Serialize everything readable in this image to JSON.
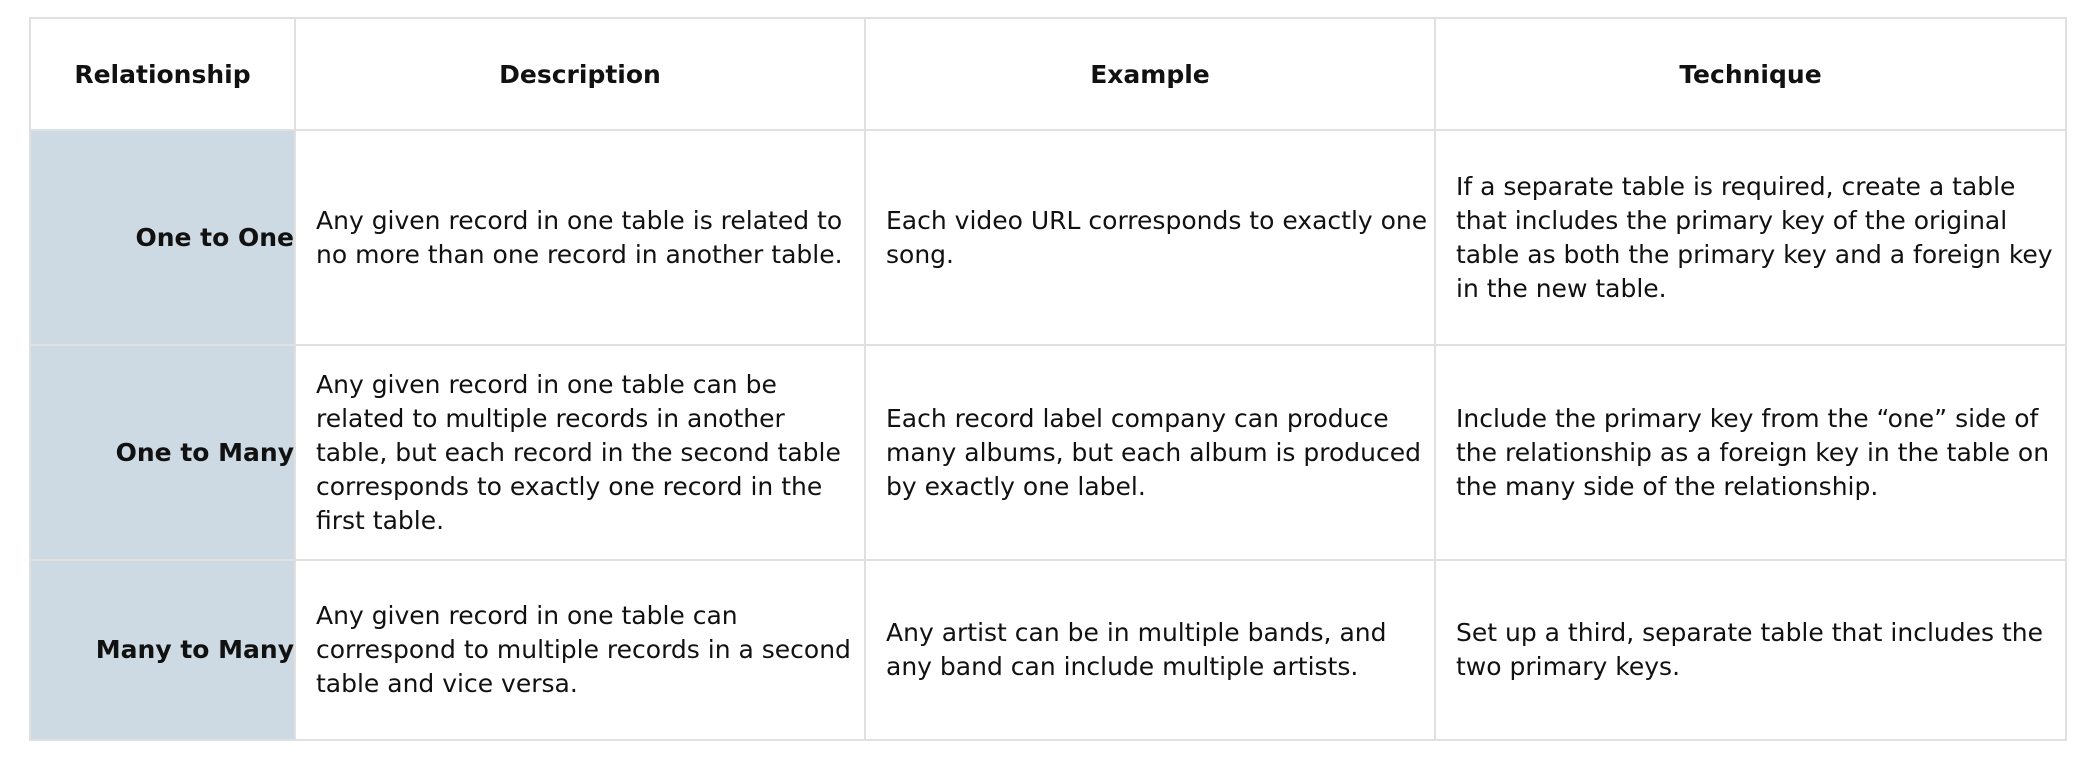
{
  "table": {
    "headers": [
      "Relationship",
      "Description",
      "Example",
      "Technique"
    ],
    "rows": [
      {
        "relationship": "One to One",
        "description": "Any given record in one table is related to no more than one record in another table.",
        "example": "Each video URL corresponds to exactly one song.",
        "technique": "If a separate table is required, create a table that includes the primary key of the original table as both the primary key and a foreign key in the new table."
      },
      {
        "relationship": "One to Many",
        "description": "Any given record in one table can be related to multiple records in another table, but each record in the second table corresponds to exactly one record in the first table.",
        "example": "Each record label company can produce many albums, but each album is produced by exactly one label.",
        "technique": "Include the primary key from the “one” side of the relationship as a foreign key in the table on the many side of the relationship."
      },
      {
        "relationship": "Many to Many",
        "description": "Any given record in one table can correspond to multiple records in a second table and vice versa.",
        "example": "Any artist can be in multiple bands, and any band can include multiple artists.",
        "technique": "Set up a third, separate table that includes the two primary keys."
      }
    ]
  },
  "colors": {
    "relationship_cell_bg": "#cdd9e3",
    "border": "#e0e0e0"
  }
}
